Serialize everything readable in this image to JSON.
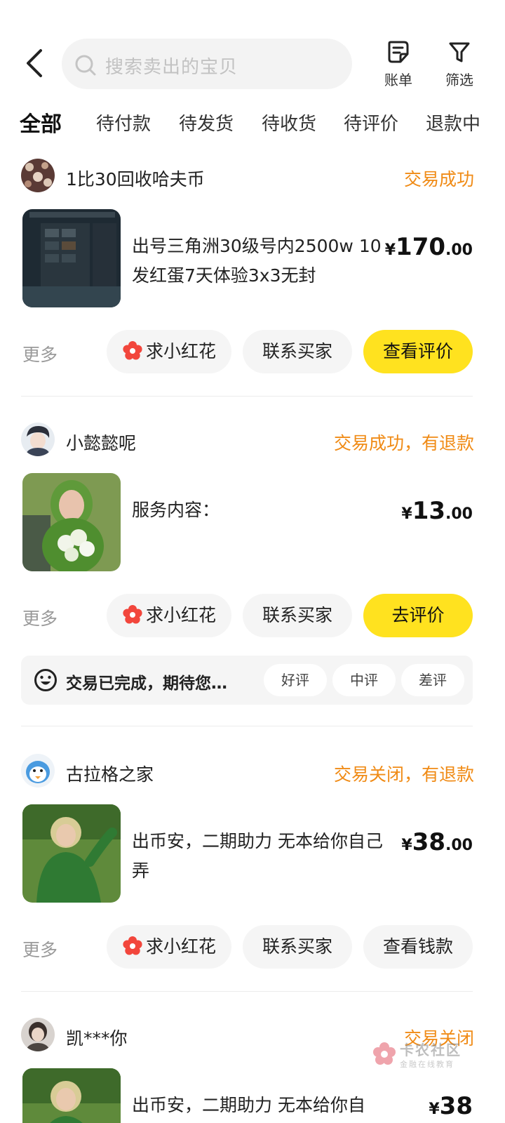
{
  "search": {
    "placeholder": "搜索卖出的宝贝"
  },
  "toolbar": {
    "bill_label": "账单",
    "filter_label": "筛选"
  },
  "tabs": [
    {
      "label": "全部",
      "active": true
    },
    {
      "label": "待付款"
    },
    {
      "label": "待发货"
    },
    {
      "label": "待收货"
    },
    {
      "label": "待评价"
    },
    {
      "label": "退款中"
    }
  ],
  "orders": [
    {
      "seller_name": "1比30回收哈夫币",
      "status": "交易成功",
      "title": "出号三角洲30级号内2500w 10发红蛋7天体验3x3无封",
      "price_currency": "¥",
      "price_int": "170",
      "price_dec": ".00",
      "more_label": "更多",
      "action_1": "求小红花",
      "action_2": "联系买家",
      "action_3": "查看评价"
    },
    {
      "seller_name": "小懿懿呢",
      "status": "交易成功，有退款",
      "title": "服务内容：",
      "price_currency": "¥",
      "price_int": "13",
      "price_dec": ".00",
      "more_label": "更多",
      "action_1": "求小红花",
      "action_2": "联系买家",
      "action_3": "去评价",
      "rate_prompt": "交易已完成，期待您…",
      "rate_good": "好评",
      "rate_mid": "中评",
      "rate_bad": "差评"
    },
    {
      "seller_name": "古拉格之家",
      "status": "交易关闭，有退款",
      "title": "出币安，二期助力 无本给你自己弄",
      "price_currency": "¥",
      "price_int": "38",
      "price_dec": ".00",
      "more_label": "更多",
      "action_1": "求小红花",
      "action_2": "联系买家",
      "action_3": "查看钱款"
    },
    {
      "seller_name": "凯***你",
      "status": "交易关闭",
      "title": "出币安，二期助力 无本给你自",
      "price_currency": "¥",
      "price_int": "38"
    }
  ],
  "watermark": {
    "line1": "卡农社区",
    "line2": "金融在线教育"
  },
  "colors": {
    "accent_yellow": "#ffe21f",
    "status_orange": "#f08b16",
    "pill_bg": "#f5f5f5"
  }
}
